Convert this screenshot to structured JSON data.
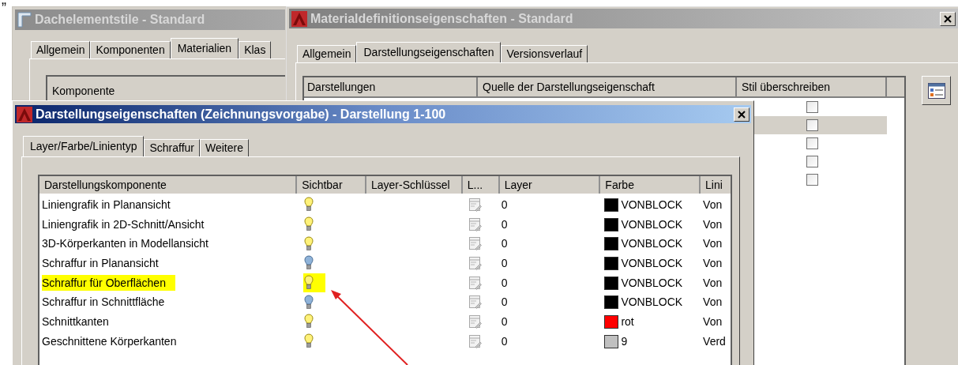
{
  "top_fragment": "„",
  "back_window": {
    "title": "Dachelementstile - Standard",
    "tabs": [
      {
        "label": "Allgemein",
        "selected": false
      },
      {
        "label": "Komponenten",
        "selected": false
      },
      {
        "label": "Materialien",
        "selected": true
      },
      {
        "label": "Klas",
        "selected": false
      }
    ],
    "column": "Komponente"
  },
  "material_window": {
    "title": "Materialdefinitionseigenschaften - Standard",
    "tabs": [
      {
        "label": "Allgemein",
        "selected": false
      },
      {
        "label": "Darstellungseigenschaften",
        "selected": true
      },
      {
        "label": "Versionsverlauf",
        "selected": false
      }
    ],
    "columns": [
      "Darstellungen",
      "Quelle der Darstellungseigenschaft",
      "Stil überschreiben"
    ],
    "rows": [
      {
        "checked": false,
        "selected": false
      },
      {
        "checked": false,
        "selected": true
      },
      {
        "checked": false,
        "selected": false
      },
      {
        "checked": false,
        "selected": false
      },
      {
        "checked": false,
        "selected": false
      }
    ]
  },
  "display_window": {
    "title": "Darstellungseigenschaften (Zeichnungsvorgabe) - Darstellung 1-100",
    "tabs": [
      {
        "label": "Layer/Farbe/Linientyp",
        "selected": true
      },
      {
        "label": "Schraffur",
        "selected": false
      },
      {
        "label": "Weitere",
        "selected": false
      }
    ],
    "columns": [
      "Darstellungskomponente",
      "Sichtbar",
      "Layer-Schlüssel",
      "L...",
      "Layer",
      "Farbe",
      "Lini"
    ],
    "rows": [
      {
        "name": "Liniengrafik in Planansicht",
        "visible": true,
        "highlighted": false,
        "layer": "0",
        "color": "#000000",
        "color_name": "VONBLOCK",
        "linetype": "Von"
      },
      {
        "name": "Liniengrafik in 2D-Schnitt/Ansicht",
        "visible": true,
        "highlighted": false,
        "layer": "0",
        "color": "#000000",
        "color_name": "VONBLOCK",
        "linetype": "Von"
      },
      {
        "name": "3D-Körperkanten in Modellansicht",
        "visible": true,
        "highlighted": false,
        "layer": "0",
        "color": "#000000",
        "color_name": "VONBLOCK",
        "linetype": "Von"
      },
      {
        "name": "Schraffur in Planansicht",
        "visible": false,
        "highlighted": false,
        "layer": "0",
        "color": "#000000",
        "color_name": "VONBLOCK",
        "linetype": "Von"
      },
      {
        "name": "Schraffur für Oberflächen",
        "visible": true,
        "highlighted": true,
        "layer": "0",
        "color": "#000000",
        "color_name": "VONBLOCK",
        "linetype": "Von"
      },
      {
        "name": "Schraffur in Schnittfläche",
        "visible": false,
        "highlighted": false,
        "layer": "0",
        "color": "#000000",
        "color_name": "VONBLOCK",
        "linetype": "Von"
      },
      {
        "name": "Schnittkanten",
        "visible": true,
        "highlighted": false,
        "layer": "0",
        "color": "#ff0000",
        "color_name": "rot",
        "linetype": "Von"
      },
      {
        "name": "Geschnittene Körperkanten",
        "visible": true,
        "highlighted": false,
        "layer": "0",
        "color": "#c0c0c0",
        "color_name": "9",
        "linetype": "Verd"
      }
    ]
  }
}
